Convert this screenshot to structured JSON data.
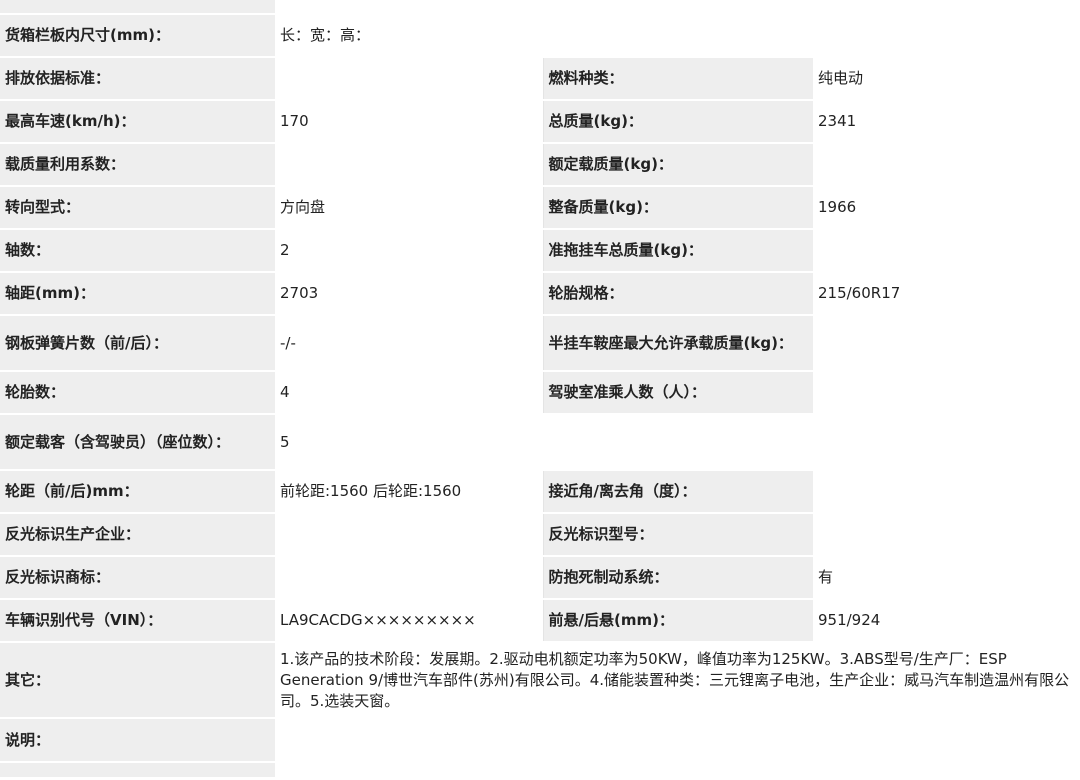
{
  "rows": [
    {
      "label": "货箱栏板内尺寸(mm)：",
      "value": "长：宽：高："
    },
    {
      "label": "排放依据标准：",
      "value": "",
      "label2": "燃料种类：",
      "value2": "纯电动"
    },
    {
      "label": "最高车速(km/h)：",
      "value": "170",
      "label2": "总质量(kg)：",
      "value2": "2341"
    },
    {
      "label": "载质量利用系数：",
      "value": "",
      "label2": "额定载质量(kg)：",
      "value2": ""
    },
    {
      "label": "转向型式：",
      "value": "方向盘",
      "label2": "整备质量(kg)：",
      "value2": "1966"
    },
    {
      "label": "轴数：",
      "value": "2",
      "label2": "准拖挂车总质量(kg)：",
      "value2": ""
    },
    {
      "label": "轴距(mm)：",
      "value": "2703",
      "label2": "轮胎规格：",
      "value2": "215/60R17"
    },
    {
      "label": "钢板弹簧片数（前/后）：",
      "value": "-/-",
      "label2": "半挂车鞍座最大允许承载质量(kg)：",
      "value2": ""
    },
    {
      "label": "轮胎数：",
      "value": "4",
      "label2": "驾驶室准乘人数（人）：",
      "value2": ""
    },
    {
      "label": "额定载客（含驾驶员）（座位数）：",
      "value": "5"
    },
    {
      "label": "轮距（前/后)mm：",
      "value": "前轮距:1560 后轮距:1560",
      "label2": "接近角/离去角（度）：",
      "value2": ""
    },
    {
      "label": "反光标识生产企业：",
      "value": "",
      "label2": "反光标识型号：",
      "value2": ""
    },
    {
      "label": "反光标识商标：",
      "value": "",
      "label2": "防抱死制动系统：",
      "value2": "有"
    },
    {
      "label": "车辆识别代号（VIN）：",
      "value": "LA9CACDG×××××××××",
      "label2": "前悬/后悬(mm)：",
      "value2": "951/924"
    },
    {
      "label": "其它：",
      "value": "1.该产品的技术阶段：发展期。2.驱动电机额定功率为50KW，峰值功率为125KW。3.ABS型号/生产厂：ESP Generation 9/博世汽车部件(苏州)有限公司。4.储能装置种类：三元锂离子电池，生产企业：威马汽车制造温州有限公司。5.选装天窗。"
    },
    {
      "label": "说明：",
      "value": ""
    }
  ]
}
